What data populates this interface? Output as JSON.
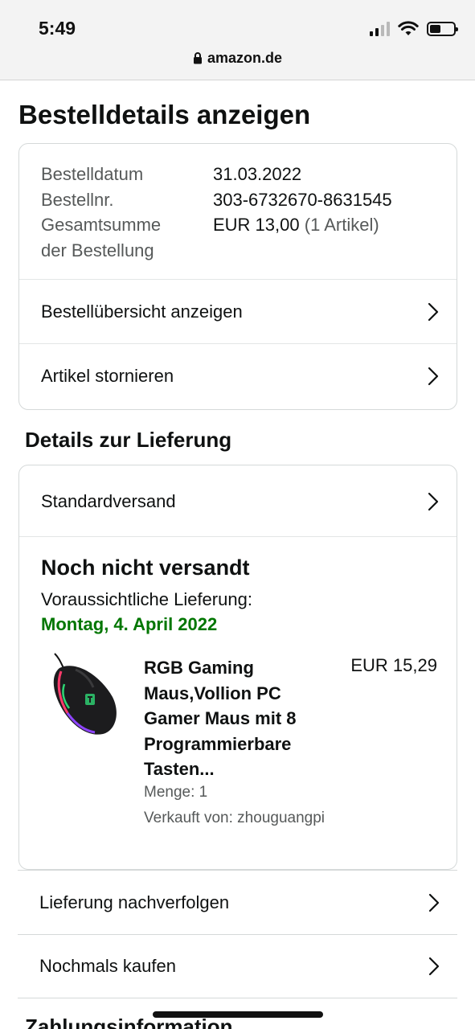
{
  "status_bar": {
    "time": "5:49",
    "icons": [
      "cellular-signal-icon",
      "wifi-icon",
      "battery-icon"
    ],
    "url": "amazon.de",
    "lock_icon": "lock-icon"
  },
  "page": {
    "title": "Bestelldetails anzeigen"
  },
  "order_summary": {
    "order_date_label": "Bestelldatum",
    "order_date": "31.03.2022",
    "order_number_label": "Bestellnr.",
    "order_number": "303-6732670-8631545",
    "total_label_line1": "Gesamtsumme",
    "total_label_line2": "der Bestellung",
    "total_value": "EUR 13,00",
    "total_items": "(1 Artikel)",
    "links": [
      {
        "label": "Bestellübersicht anzeigen",
        "icon": "chevron-right-icon"
      },
      {
        "label": "Artikel stornieren",
        "icon": "chevron-right-icon"
      }
    ]
  },
  "delivery": {
    "section_title": "Details zur Lieferung",
    "shipping_method": "Standardversand",
    "status": "Noch nicht versandt",
    "expected_label": "Voraussichtliche Lieferung:",
    "expected_date": "Montag, 4. April 2022",
    "expected_date_color": "#007600",
    "product": {
      "image": "gaming-mouse-image",
      "title": "RGB Gaming Maus,Vollion PC Gamer Maus mit 8 Programmierbare Tasten...",
      "price": "EUR 15,29",
      "quantity": "Menge: 1",
      "seller": "Verkauft von: zhouguangpi"
    },
    "actions": [
      {
        "label": "Lieferung nachverfolgen",
        "icon": "chevron-right-icon"
      },
      {
        "label": "Nochmals kaufen",
        "icon": "chevron-right-icon"
      }
    ]
  },
  "next_section": {
    "title": "Zahlungsinformation"
  }
}
